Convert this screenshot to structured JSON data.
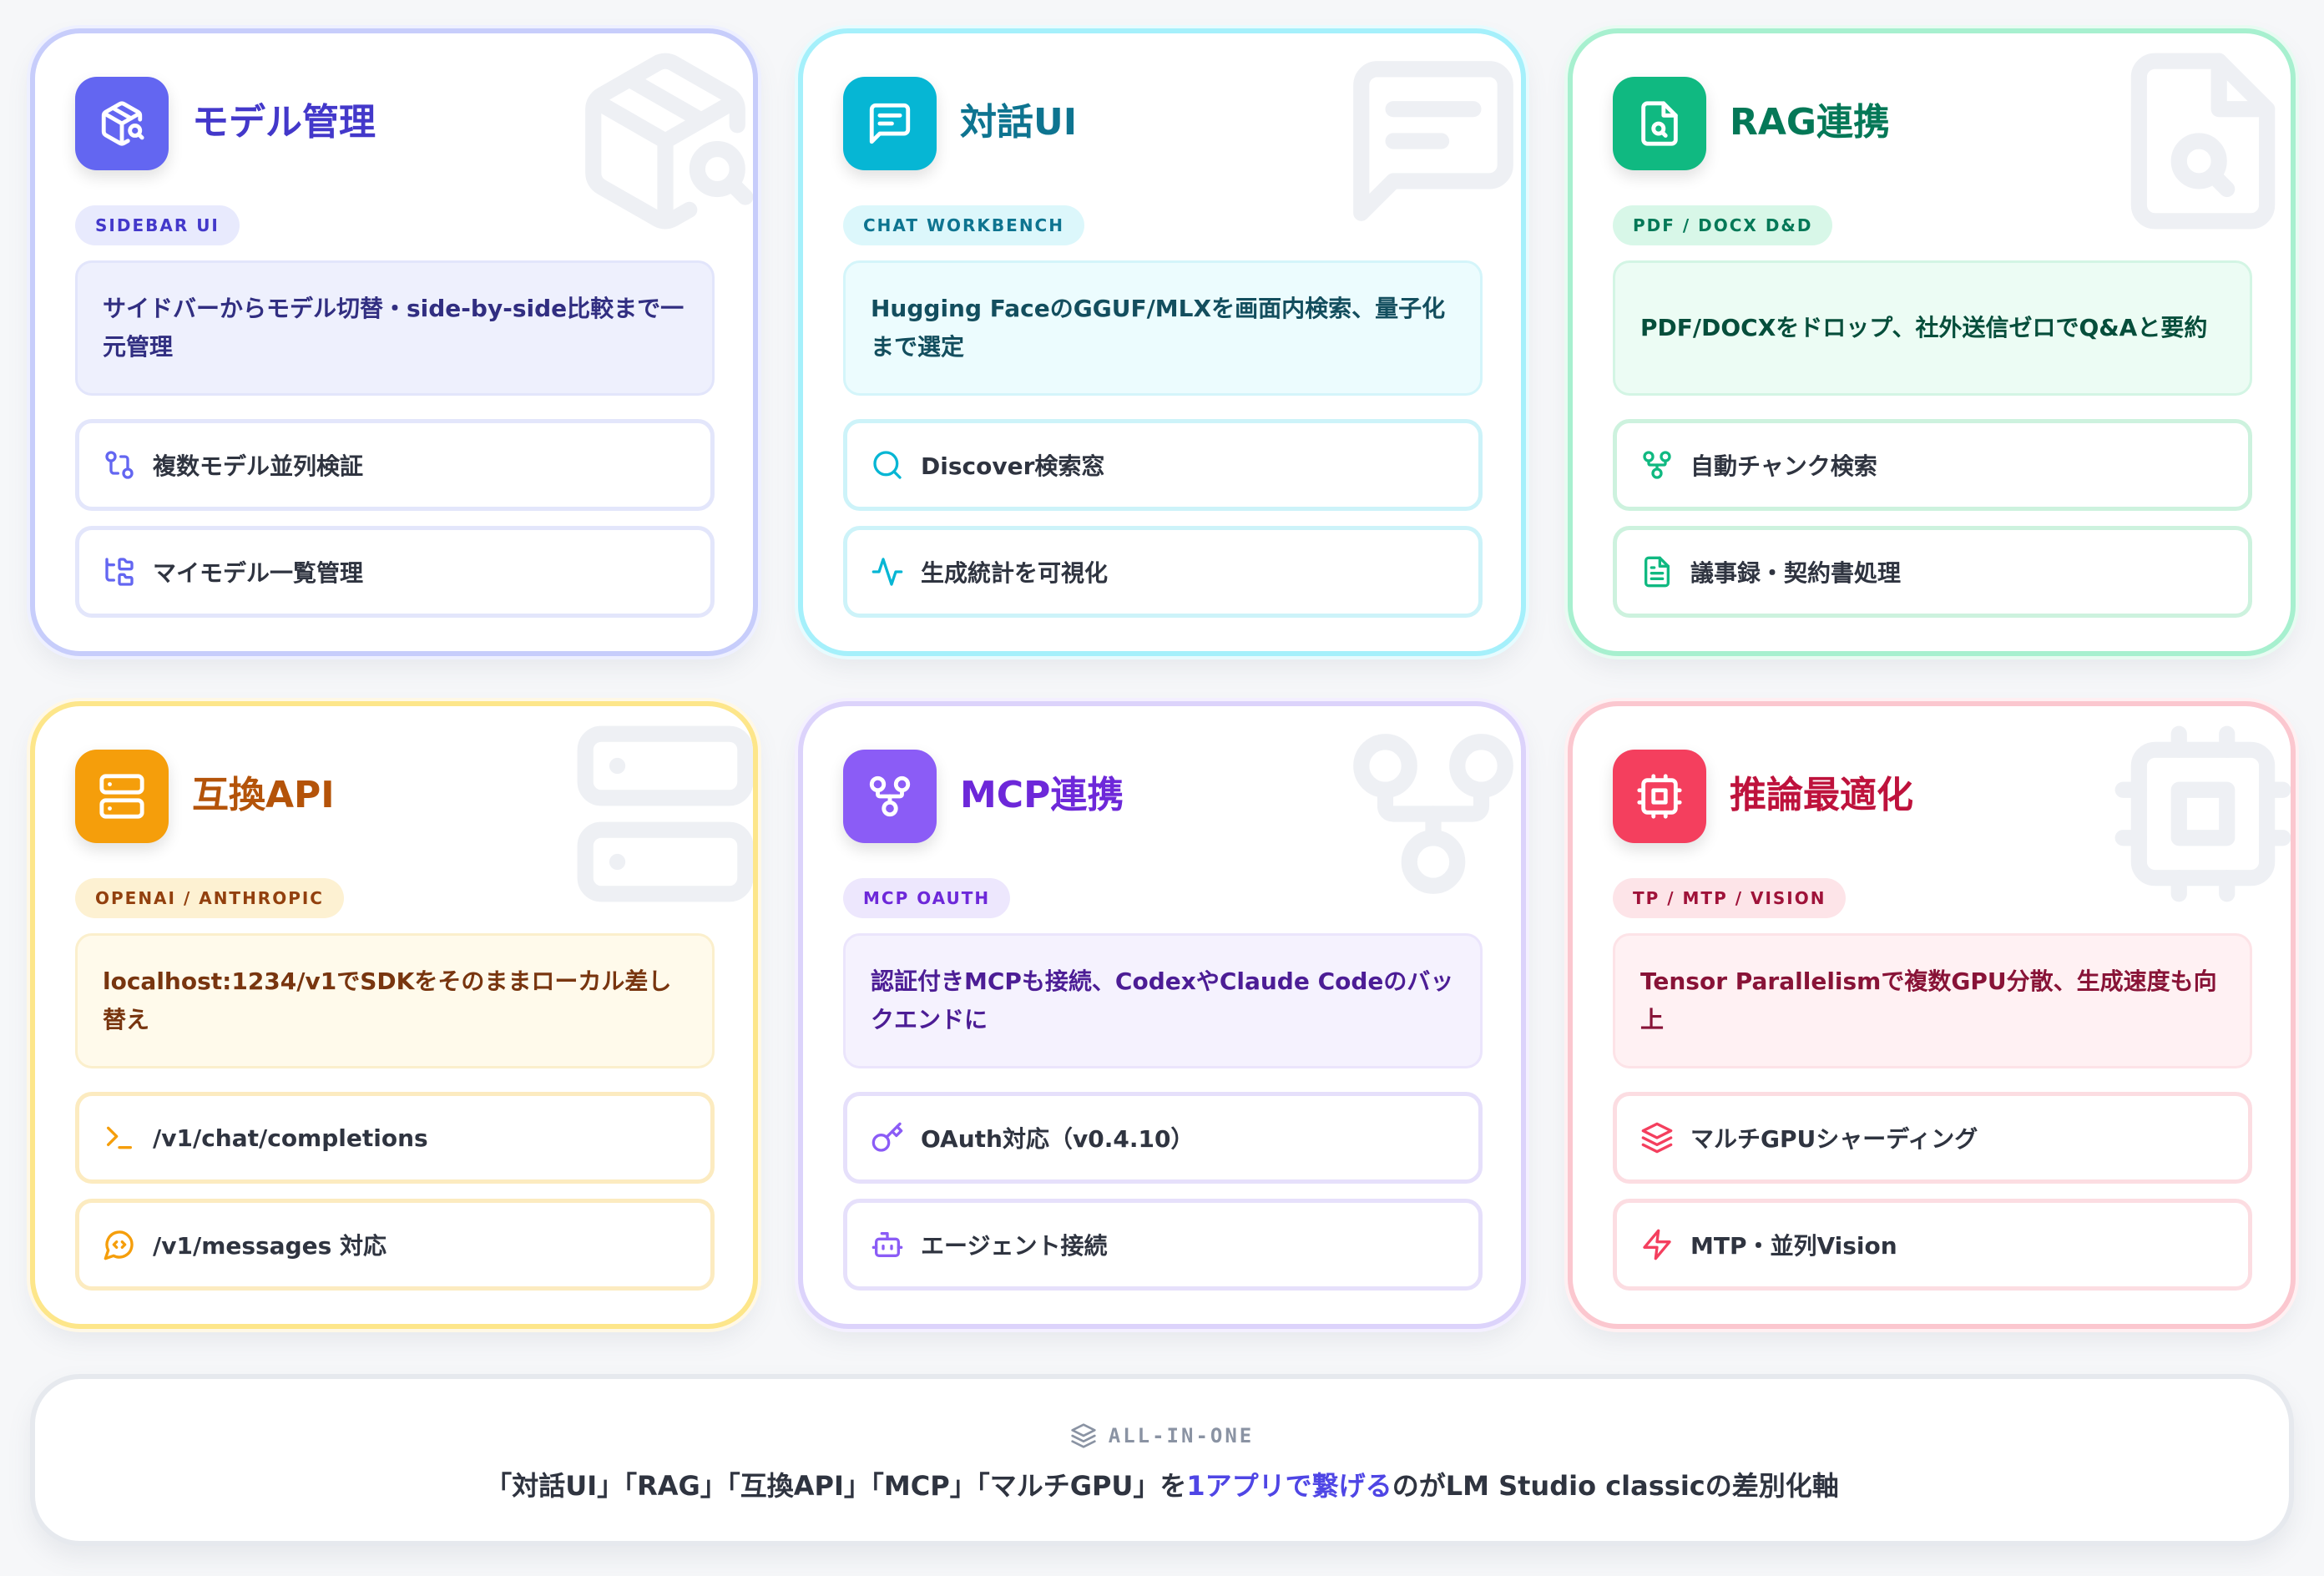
{
  "cards": [
    {
      "title": "モデル管理",
      "badge": "SIDEBAR UI",
      "description": "サイドバーからモデル切替・side-by-side比較まで一元管理",
      "icon": "package-search-icon",
      "features": [
        {
          "label": "複数モデル並列検証",
          "icon": "git-compare-icon"
        },
        {
          "label": "マイモデル一覧管理",
          "icon": "folder-tree-icon"
        }
      ],
      "colors": {
        "accent": "#6366f1",
        "title": "#4338ca",
        "border": "#c7cdfb"
      }
    },
    {
      "title": "対話UI",
      "badge": "CHAT WORKBENCH",
      "description": "Hugging FaceのGGUF/MLXを画面内検索、量子化まで選定",
      "icon": "chat-square-icon",
      "features": [
        {
          "label": "Discover検索窓",
          "icon": "search-icon"
        },
        {
          "label": "生成統計を可視化",
          "icon": "activity-icon"
        }
      ],
      "colors": {
        "accent": "#06b6d4",
        "title": "#0e7490",
        "border": "#a5f0fb"
      }
    },
    {
      "title": "RAG連携",
      "badge": "PDF / DOCX D&D",
      "description": "PDF/DOCXをドロップ、社外送信ゼロでQ&Aと要約",
      "icon": "file-search-icon",
      "features": [
        {
          "label": "自動チャンク検索",
          "icon": "git-fork-icon"
        },
        {
          "label": "議事録・契約書処理",
          "icon": "file-text-icon"
        }
      ],
      "colors": {
        "accent": "#10b981",
        "title": "#047857",
        "border": "#a7f0cf"
      }
    },
    {
      "title": "互換API",
      "badge": "OPENAI / ANTHROPIC",
      "description": "localhost:1234/v1でSDKをそのままローカル差し替え",
      "icon": "server-icon",
      "features": [
        {
          "label": "/v1/chat/completions",
          "icon": "terminal-icon"
        },
        {
          "label": "/v1/messages 対応",
          "icon": "message-code-icon"
        }
      ],
      "colors": {
        "accent": "#f59e0b",
        "title": "#b45309",
        "border": "#fde68a"
      }
    },
    {
      "title": "MCP連携",
      "badge": "MCP OAUTH",
      "description": "認証付きMCPも接続、CodexやClaude Codeのバックエンドに",
      "icon": "workflow-icon",
      "features": [
        {
          "label": "OAuth対応（v0.4.10）",
          "icon": "key-icon"
        },
        {
          "label": "エージェント接続",
          "icon": "bot-icon"
        }
      ],
      "colors": {
        "accent": "#8b5cf6",
        "title": "#6d28d9",
        "border": "#dcd3fb"
      }
    },
    {
      "title": "推論最適化",
      "badge": "TP / MTP / VISION",
      "description": "Tensor Parallelismで複数GPU分散、生成速度も向上",
      "icon": "cpu-icon",
      "features": [
        {
          "label": "マルチGPUシャーディング",
          "icon": "layers-icon"
        },
        {
          "label": "MTP・並列Vision",
          "icon": "zap-icon"
        }
      ],
      "colors": {
        "accent": "#f43f5e",
        "title": "#be123c",
        "border": "#fbc7cf"
      }
    }
  ],
  "footer": {
    "label": "ALL-IN-ONE",
    "icon": "layers-icon",
    "text_before": "「対話UI」「RAG」「互換API」「MCP」「マルチGPU」を",
    "text_highlight": "1アプリで繋げる",
    "text_after": "のがLM Studio classicの差別化軸",
    "highlight_color": "#4f46e5"
  }
}
